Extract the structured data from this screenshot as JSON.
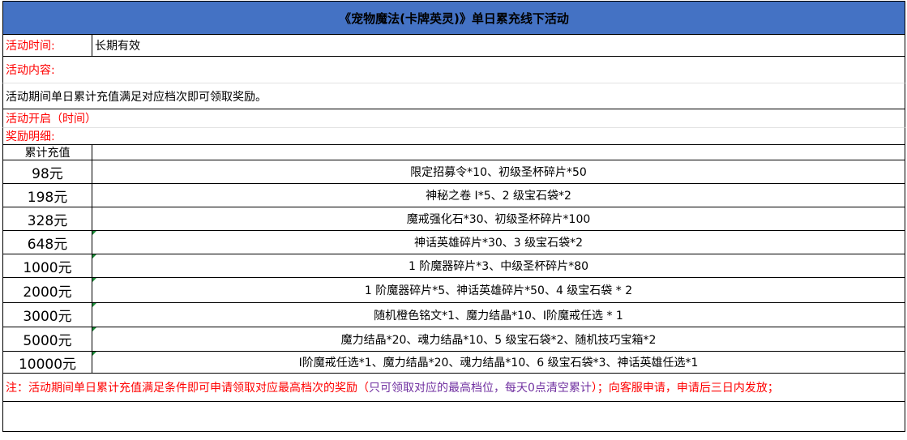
{
  "title": "《宠物魔法(卡牌英灵)》单日累充线下活动",
  "time_label": "活动时间:",
  "time_value": "长期有效",
  "content_label": "活动内容:",
  "content_text": "活动期间单日累计充值满足对应档次即可领取奖励。",
  "open_label": "活动开启（时间）",
  "detail_label": "奖励明细:",
  "header_col1": "累计充值",
  "rewards": [
    {
      "amount": "98元",
      "reward": "限定招募令*10、初级圣杯碎片*50"
    },
    {
      "amount": "198元",
      "reward": "神秘之卷 Ⅰ*5、2 级宝石袋*2"
    },
    {
      "amount": "328元",
      "reward": "魔戒强化石*30、初级圣杯碎片*100"
    },
    {
      "amount": "648元",
      "reward": "神话英雄碎片*30、3 级宝石袋*2"
    },
    {
      "amount": "1000元",
      "reward": "1 阶魔器碎片*3、中级圣杯碎片*80"
    },
    {
      "amount": "2000元",
      "reward": "1 阶魔器碎片*5、神话英雄碎片*50、4 级宝石袋 * 2"
    },
    {
      "amount": "3000元",
      "reward": "随机橙色铭文*1、魔力结晶*10、Ⅰ阶魔戒任选 * 1"
    },
    {
      "amount": "5000元",
      "reward": "魔力结晶*20、魂力结晶*10、5 级宝石袋*2、随机技巧宝箱*2"
    },
    {
      "amount": "10000元",
      "reward": "Ⅰ阶魔戒任选*1、魔力结晶*20、魂力结晶*10、6 级宝石袋*3、神话英雄任选*1"
    }
  ],
  "note_part1": "注：活动期间单日累计充值满足条件即可申请领取对应最高档次的奖励（",
  "note_part2": "只可领取对应的最高档位，每天0点清空累计",
  "note_part3": "）；向客服申请，申请后三日内发放；",
  "colors": {
    "header_bg": "#4472c4",
    "label_red": "#ff0000",
    "note_purple": "#7030a0",
    "cell_marker": "#1e8c3a"
  }
}
